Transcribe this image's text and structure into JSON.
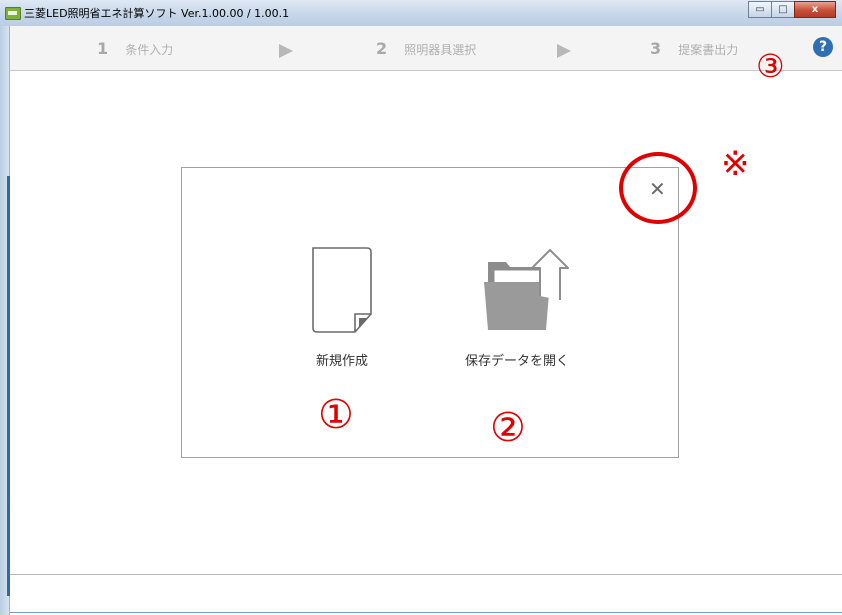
{
  "window": {
    "title": "三菱LED照明省エネ計算ソフト Ver.1.00.00 / 1.00.1",
    "minimize_label": "▭",
    "maximize_label": "□",
    "close_label": "x"
  },
  "steps": [
    {
      "number": "1",
      "label": "条件入力"
    },
    {
      "number": "2",
      "label": "照明器具選択"
    },
    {
      "number": "3",
      "label": "提案書出力"
    }
  ],
  "help": {
    "label": "?"
  },
  "dialog": {
    "close_glyph": "✕",
    "new_label": "新規作成",
    "open_label": "保存データを開く"
  },
  "annotations": {
    "mark1": "①",
    "mark2": "②",
    "mark3": "③",
    "note": "※"
  },
  "colors": {
    "annotation_red": "#e00000",
    "help_blue": "#2e6fb3",
    "folder_gray": "#8c8c8c"
  }
}
